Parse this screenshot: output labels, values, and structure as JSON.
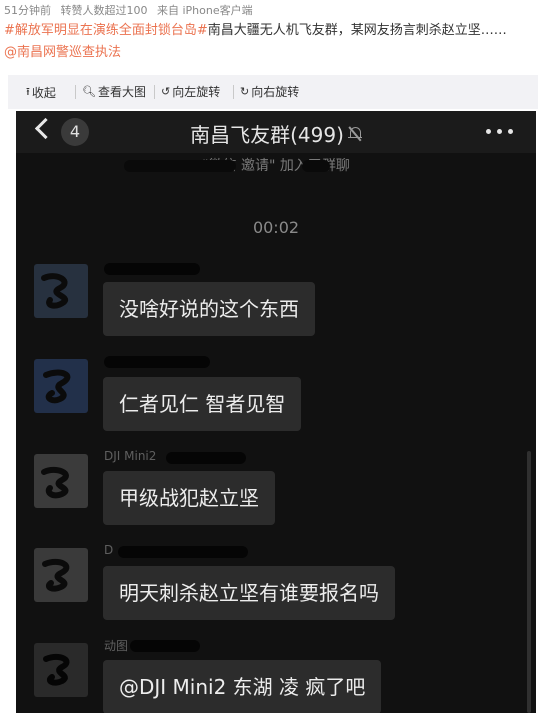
{
  "meta": {
    "time_ago": "51分钟前",
    "forward_stat": "转赞人数超过100",
    "source": "来自 iPhone客户端"
  },
  "post": {
    "tag1": "#解放军明显在演练全面封锁台岛#",
    "text": "南昌大疆无人机飞友群，某网友扬言刺杀赵立坚……",
    "mention": "@南昌网警巡查执法"
  },
  "toolbar": {
    "collapse": "收起",
    "view_large": "查看大图",
    "rotate_left": "向左旋转",
    "rotate_right": "向右旋转"
  },
  "chat": {
    "unread_count": "4",
    "group_title": "南昌飞友群(499)",
    "system_msg": "\"微信          邀请\"  加入了群聊",
    "time": "00:02",
    "name_fragments": [
      "DJI Mini2",
      "D",
      "动图"
    ],
    "messages": [
      {
        "text": "没啥好说的这个东西"
      },
      {
        "text": "仁者见仁 智者见智"
      },
      {
        "text": "甲级战犯赵立坚"
      },
      {
        "text": "明天刺杀赵立坚有谁要报名吗"
      },
      {
        "text": "@DJI Mini2 东湖  凌  疯了吧"
      }
    ]
  },
  "colors": {
    "accent": "#eb7350",
    "chat_bg": "#111111",
    "bubble": "#2c2c2c"
  }
}
